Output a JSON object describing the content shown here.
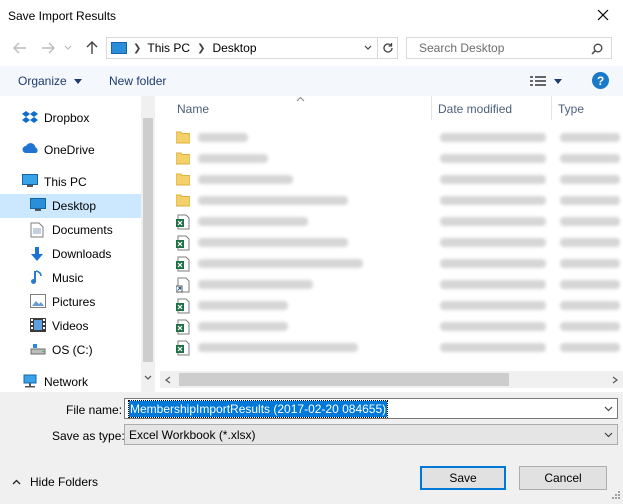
{
  "window": {
    "title": "Save Import Results"
  },
  "address": {
    "segments": [
      "This PC",
      "Desktop"
    ]
  },
  "search": {
    "placeholder": "Search Desktop"
  },
  "toolbar": {
    "organize": "Organize",
    "new_folder": "New folder"
  },
  "sidebar": {
    "items": [
      {
        "label": "Dropbox",
        "icon": "dropbox-icon"
      },
      {
        "label": "OneDrive",
        "icon": "cloud-icon"
      },
      {
        "label": "This PC",
        "icon": "computer-icon"
      },
      {
        "label": "Desktop",
        "icon": "desktop-icon",
        "selected": true
      },
      {
        "label": "Documents",
        "icon": "document-icon"
      },
      {
        "label": "Downloads",
        "icon": "download-icon"
      },
      {
        "label": "Music",
        "icon": "music-icon"
      },
      {
        "label": "Pictures",
        "icon": "picture-icon"
      },
      {
        "label": "Videos",
        "icon": "video-icon"
      },
      {
        "label": "OS (C:)",
        "icon": "drive-icon"
      },
      {
        "label": "Network",
        "icon": "network-icon"
      }
    ]
  },
  "columns": {
    "name": "Name",
    "date": "Date modified",
    "type": "Type"
  },
  "files": [
    {
      "kind": "folder"
    },
    {
      "kind": "folder"
    },
    {
      "kind": "folder"
    },
    {
      "kind": "folder"
    },
    {
      "kind": "excel"
    },
    {
      "kind": "excel"
    },
    {
      "kind": "excel"
    },
    {
      "kind": "shortcut"
    },
    {
      "kind": "excel"
    },
    {
      "kind": "excel"
    },
    {
      "kind": "excel"
    }
  ],
  "form": {
    "file_name_label": "File name:",
    "file_name_value": "MembershipImportResults (2017-02-20 084655)",
    "save_type_label": "Save as type:",
    "save_type_value": "Excel Workbook (*.xlsx)"
  },
  "footer": {
    "hide_folders": "Hide Folders",
    "save": "Save",
    "cancel": "Cancel"
  },
  "colors": {
    "accent": "#0078d7",
    "selection": "#cce8ff",
    "help": "#1979ca"
  }
}
